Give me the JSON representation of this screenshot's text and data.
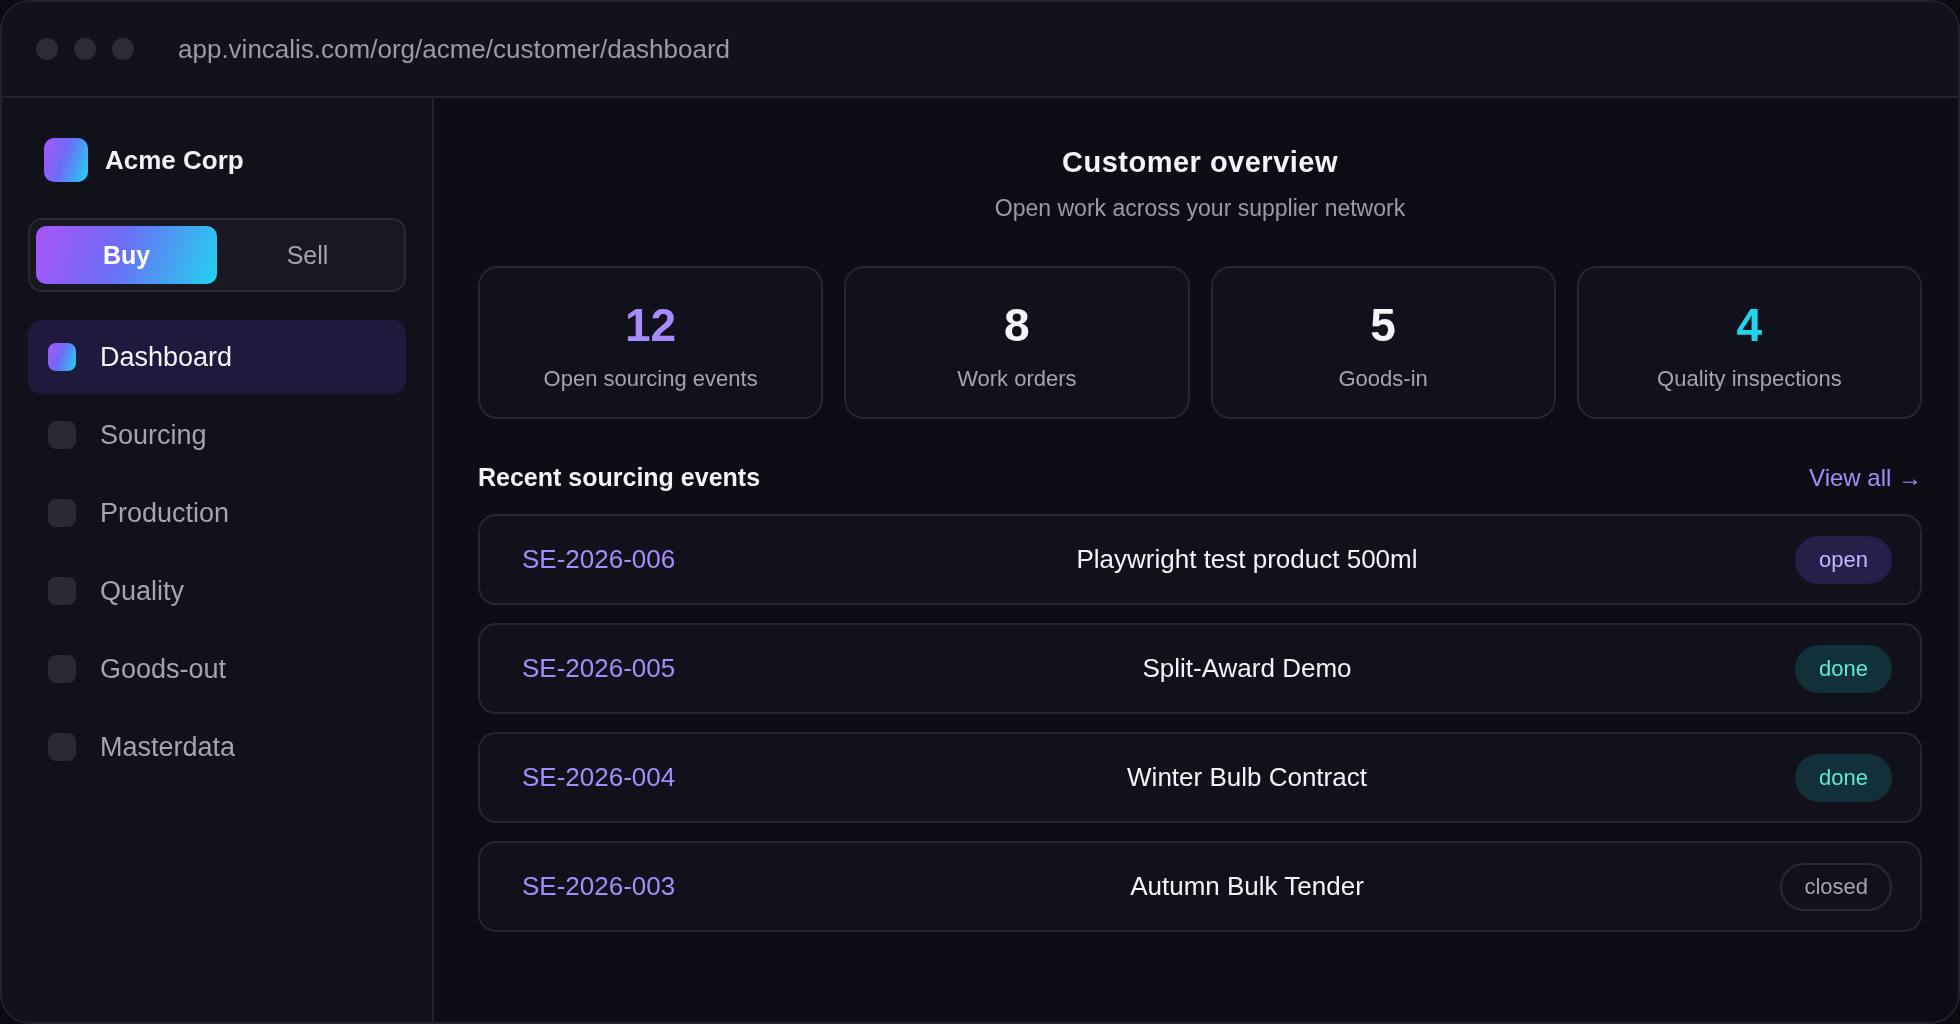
{
  "window": {
    "url": "app.vincalis.com/org/acme/customer/dashboard"
  },
  "sidebar": {
    "org": "Acme Corp",
    "modes": [
      {
        "label": "Buy",
        "selected": true
      },
      {
        "label": "Sell",
        "selected": false
      }
    ],
    "items": [
      {
        "label": "Dashboard",
        "selected": true
      },
      {
        "label": "Sourcing",
        "selected": false
      },
      {
        "label": "Production",
        "selected": false
      },
      {
        "label": "Quality",
        "selected": false
      },
      {
        "label": "Goods-out",
        "selected": false
      },
      {
        "label": "Masterdata",
        "selected": false
      }
    ]
  },
  "header": {
    "title": "Customer overview",
    "subtitle": "Open work across your supplier network"
  },
  "stats": [
    {
      "value": "12",
      "label": "Open sourcing events",
      "color": "#a78bfa"
    },
    {
      "value": "8",
      "label": "Work orders",
      "color": "#f4f4f8"
    },
    {
      "value": "5",
      "label": "Goods-in",
      "color": "#f4f4f8"
    },
    {
      "value": "4",
      "label": "Quality inspections",
      "color": "#22d3ee"
    }
  ],
  "recent": {
    "title": "Recent sourcing events",
    "link": "View all →",
    "rows": [
      {
        "id": "SE-2026-006",
        "name": "Playwright test product 500ml",
        "status": "open"
      },
      {
        "id": "SE-2026-005",
        "name": "Split-Award Demo",
        "status": "done"
      },
      {
        "id": "SE-2026-004",
        "name": "Winter Bulb Contract",
        "status": "done"
      },
      {
        "id": "SE-2026-003",
        "name": "Autumn Bulk Tender",
        "status": "closed"
      }
    ]
  }
}
